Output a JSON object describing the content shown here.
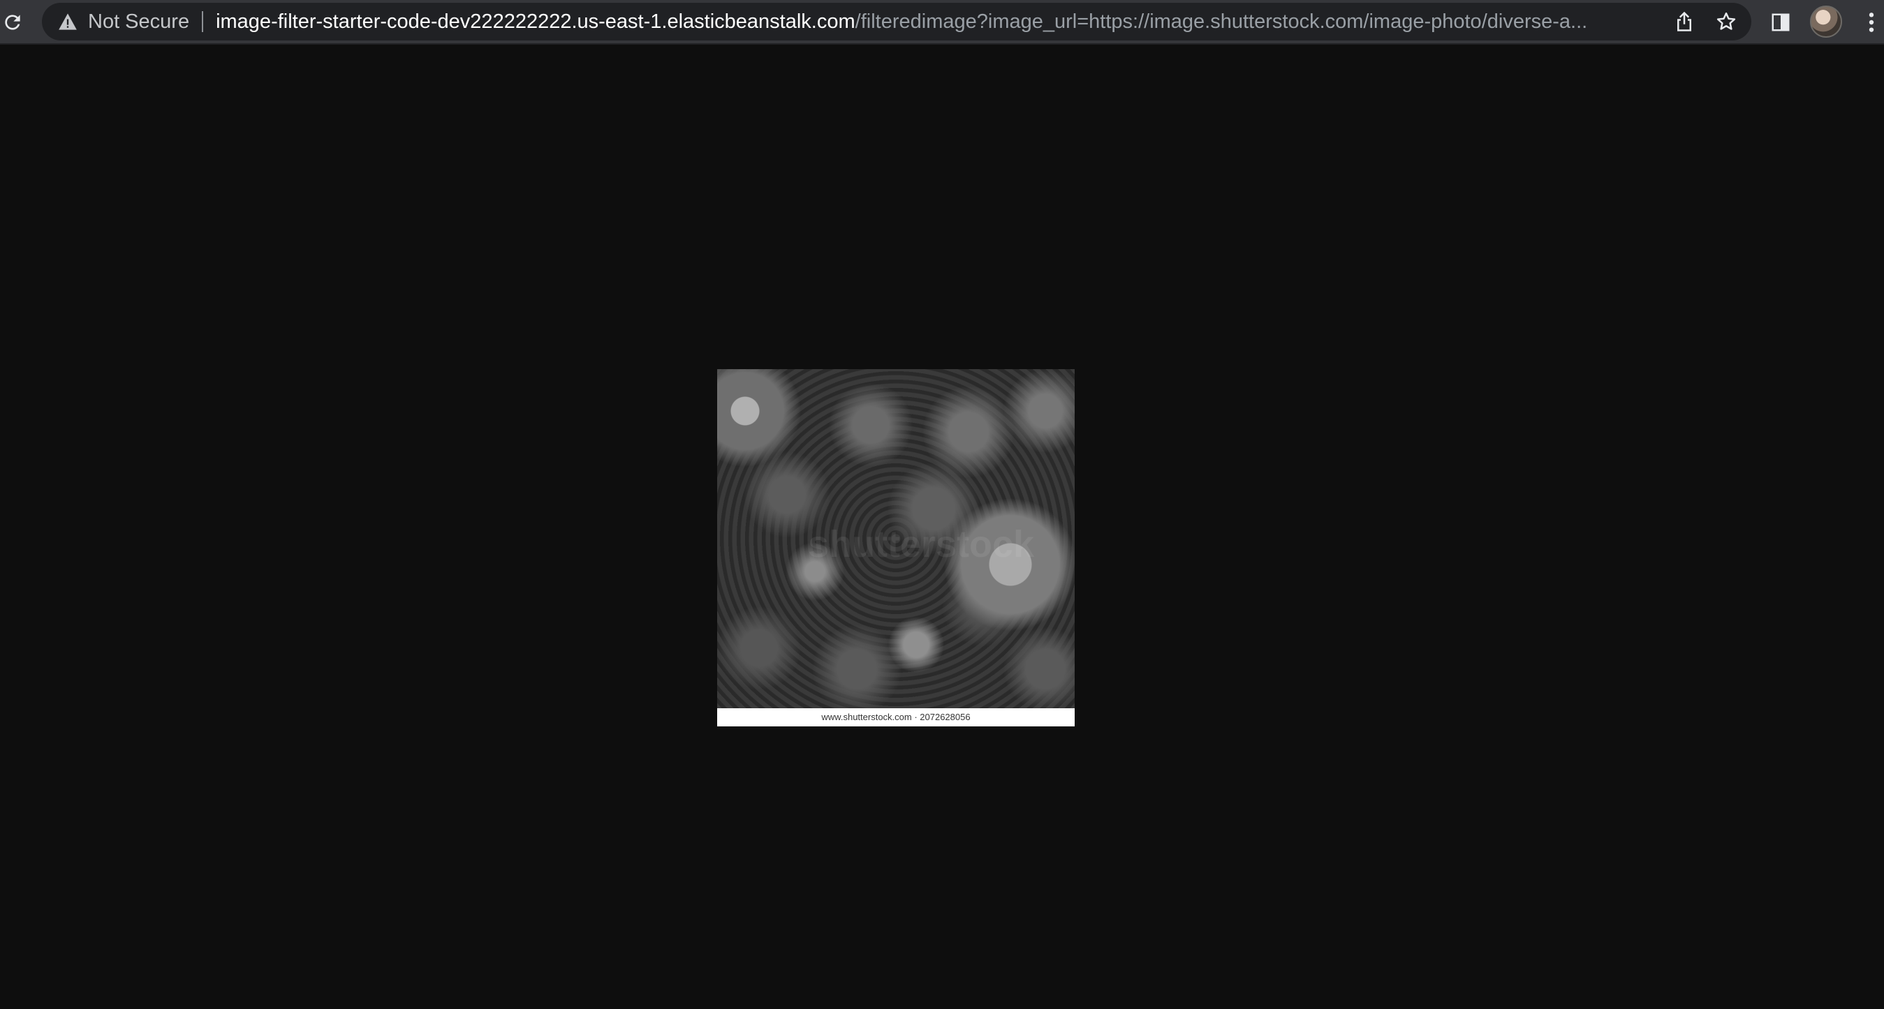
{
  "browser": {
    "reload_icon": "reload-icon",
    "security_icon": "warning-triangle-icon",
    "security_label": "Not Secure",
    "url_host": "image-filter-starter-code-dev222222222.us-east-1.elasticbeanstalk.com",
    "url_rest": "/filteredimage?image_url=https://image.shutterstock.com/image-photo/diverse-a...",
    "actions": [
      "share-icon",
      "bookmark-star-icon",
      "side-panel-icon",
      "avatar",
      "menu-kebab-icon"
    ]
  },
  "content": {
    "image_caption": "www.shutterstock.com · 2072628056",
    "watermark_text": "shutterstock"
  }
}
